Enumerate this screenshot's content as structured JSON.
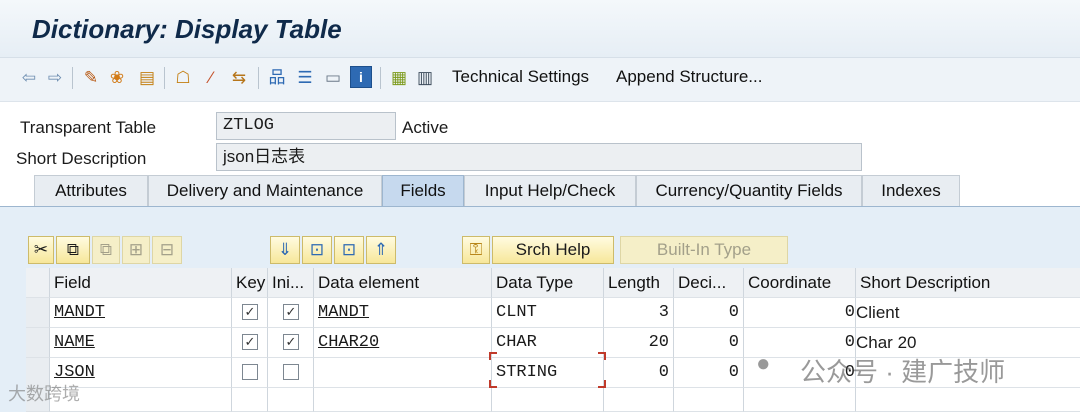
{
  "title": "Dictionary: Display Table",
  "toolbar": {
    "technical_settings": "Technical Settings",
    "append_structure": "Append Structure..."
  },
  "header": {
    "table_type_label": "Transparent Table",
    "table_name": "ZTLOG",
    "status": "Active",
    "short_desc_label": "Short Description",
    "short_desc_value": "json日志表"
  },
  "tabs": [
    {
      "label": "Attributes"
    },
    {
      "label": "Delivery and Maintenance"
    },
    {
      "label": "Fields"
    },
    {
      "label": "Input Help/Check"
    },
    {
      "label": "Currency/Quantity Fields"
    },
    {
      "label": "Indexes"
    }
  ],
  "grid_toolbar": {
    "srch_help": "Srch Help",
    "builtin_type": "Built-In Type"
  },
  "columns": [
    "Field",
    "Key",
    "Ini...",
    "Data element",
    "Data Type",
    "Length",
    "Deci...",
    "Coordinate",
    "Short Description"
  ],
  "rows": [
    {
      "field": "MANDT",
      "key": true,
      "init": true,
      "data_element": "MANDT",
      "data_type": "CLNT",
      "length": "3",
      "decimals": "0",
      "coordinate": "0",
      "short_desc": "Client"
    },
    {
      "field": "NAME",
      "key": true,
      "init": true,
      "data_element": "CHAR20",
      "data_type": "CHAR",
      "length": "20",
      "decimals": "0",
      "coordinate": "0",
      "short_desc": "Char 20"
    },
    {
      "field": "JSON",
      "key": false,
      "init": false,
      "data_element": "",
      "data_type": "STRING",
      "length": "0",
      "decimals": "0",
      "coordinate": "0",
      "short_desc": ""
    }
  ],
  "watermark": {
    "left": "大数跨境",
    "right": "公众号 · 建广技师"
  },
  "icons": [
    "back-icon",
    "forward-icon",
    "edit-icon",
    "compare-icon",
    "activate-icon",
    "hierarchy-icon",
    "wand-icon",
    "where-used-icon",
    "object-list-icon",
    "display-object-icon",
    "info-icon",
    "layout-icon",
    "table-icon",
    "cut-icon",
    "copy-icon",
    "paste-icon",
    "insert-row-icon",
    "delete-row-icon",
    "first-icon",
    "prev-page-icon",
    "next-page-icon",
    "last-icon",
    "search-help-icon"
  ]
}
